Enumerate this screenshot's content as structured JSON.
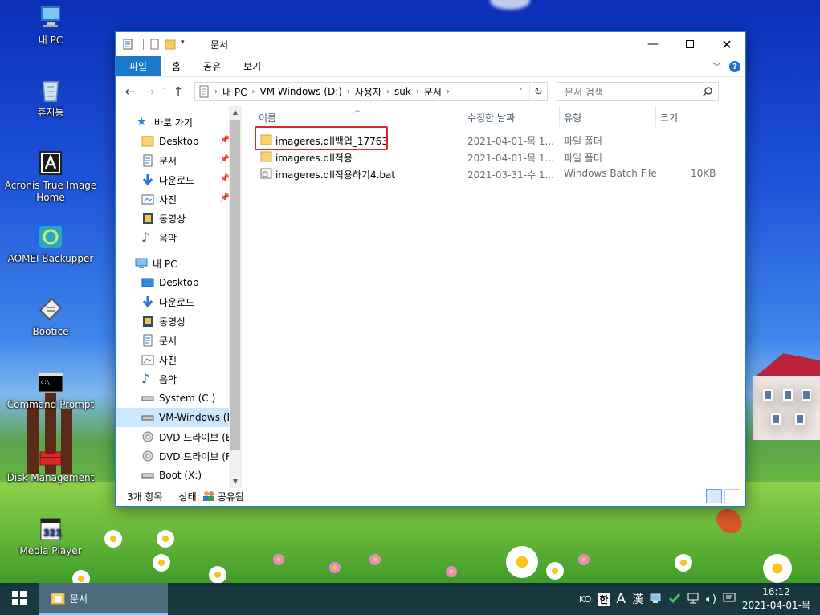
{
  "desktop": {
    "icons": [
      {
        "label": "내 PC"
      },
      {
        "label": "휴지통"
      },
      {
        "label": "Acronis True Image Home"
      },
      {
        "label": "AOMEI Backupper"
      },
      {
        "label": "Bootice"
      },
      {
        "label": "Command Prompt"
      },
      {
        "label": "Disk Management"
      },
      {
        "label": "Media Player"
      }
    ]
  },
  "window": {
    "title": "문서",
    "ribbon_tabs": [
      "파일",
      "홈",
      "공유",
      "보기"
    ],
    "help": "?",
    "address": [
      "내 PC",
      "VM-Windows (D:)",
      "사용자",
      "suk",
      "문서"
    ],
    "search_placeholder": "문서 검색",
    "nav": {
      "quick_access": "바로 가기",
      "quick_items": [
        "Desktop",
        "문서",
        "다운로드",
        "사진",
        "동영상",
        "음악"
      ],
      "this_pc": "내 PC",
      "pc_items": [
        "Desktop",
        "다운로드",
        "동영상",
        "문서",
        "사진",
        "음악",
        "System (C:)",
        "VM-Windows (D:)",
        "DVD 드라이브 (E:)",
        "DVD 드라이브 (F:)",
        "Boot (X:)"
      ]
    },
    "columns": {
      "name": "이름",
      "date": "수정한 날짜",
      "type": "유형",
      "size": "크기"
    },
    "files": [
      {
        "name": "imageres.dll백업_17763",
        "date": "2021-04-01-목 1...",
        "type": "파일 폴더",
        "size": "",
        "kind": "folder"
      },
      {
        "name": "imageres.dll적용",
        "date": "2021-04-01-목 1...",
        "type": "파일 폴더",
        "size": "",
        "kind": "folder"
      },
      {
        "name": "imageres.dll적용하기4.bat",
        "date": "2021-03-31-수 1...",
        "type": "Windows Batch File",
        "size": "10KB",
        "kind": "bat"
      }
    ],
    "status": {
      "count": "3개 항목",
      "state": "상태:",
      "shared": "공유됨"
    }
  },
  "taskbar": {
    "app": "문서",
    "lang": "KO",
    "ime1": "한",
    "ime2": "A",
    "ime3": "漢",
    "time": "16:12",
    "date": "2021-04-01-목"
  },
  "colors": {
    "accent": "#1979ca",
    "highlight_border": "#d9262c",
    "selection": "#cce8ff"
  }
}
